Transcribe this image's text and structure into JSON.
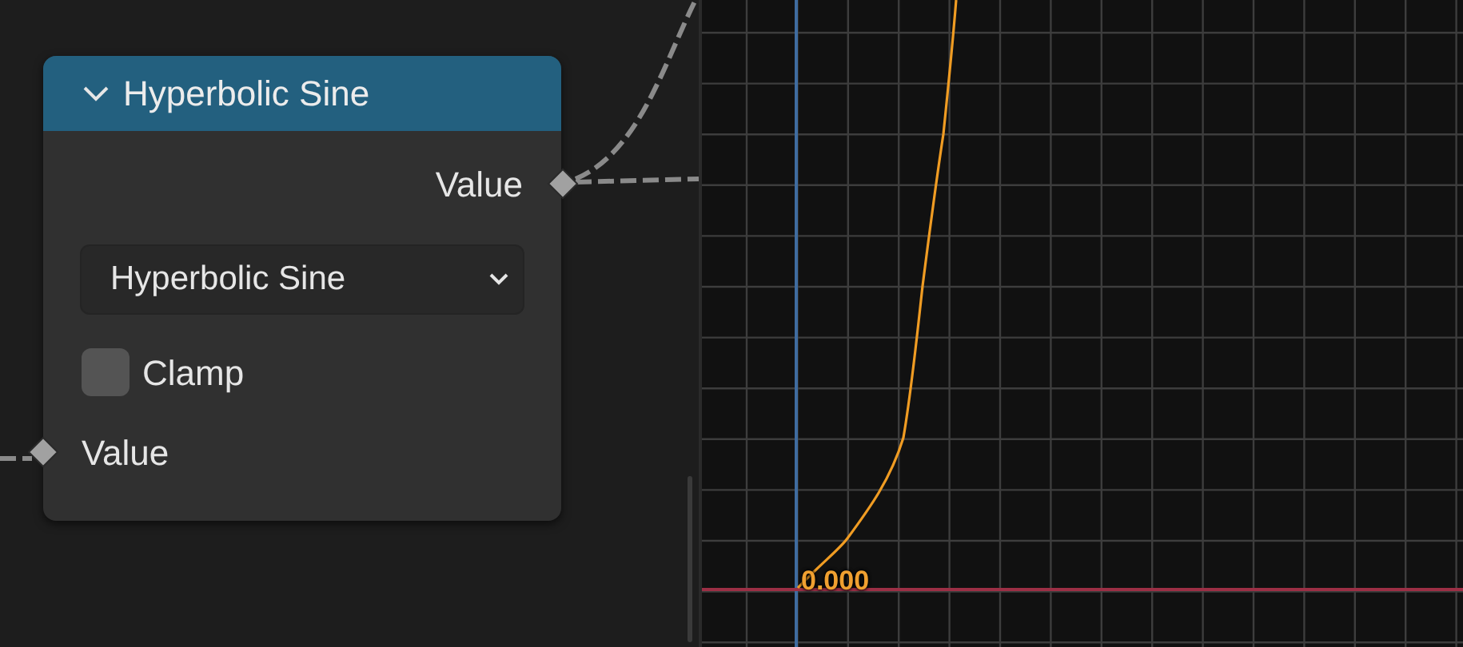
{
  "node": {
    "title": "Hyperbolic Sine",
    "expanded": true,
    "outputs": [
      {
        "label": "Value"
      }
    ],
    "dropdown": {
      "value": "Hyperbolic Sine"
    },
    "clamp": {
      "label": "Clamp",
      "checked": false
    },
    "inputs": [
      {
        "label": "Value"
      }
    ]
  },
  "graph": {
    "value_label": "0.000"
  }
}
